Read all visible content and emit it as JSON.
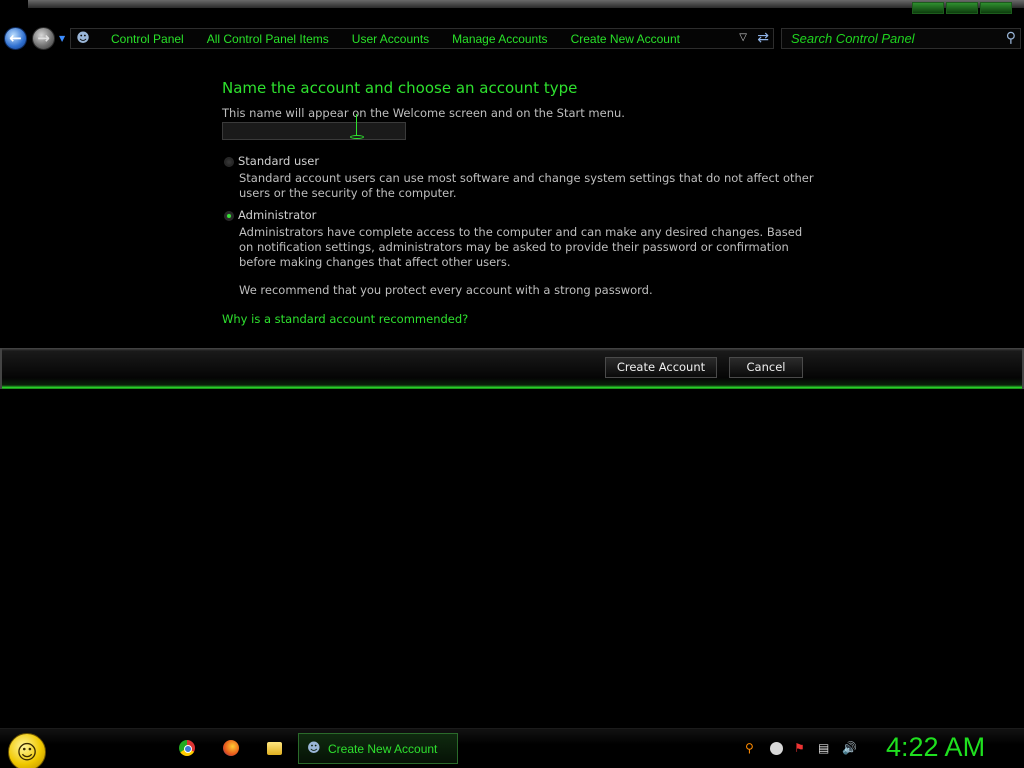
{
  "navigation": {
    "breadcrumbs": [
      "Control Panel",
      "All Control Panel Items",
      "User Accounts",
      "Manage Accounts",
      "Create New Account"
    ],
    "search_placeholder": "Search Control Panel"
  },
  "form": {
    "heading": "Name the account and choose an account type",
    "hint": "This name will appear on the Welcome screen and on the Start menu.",
    "name_value": "",
    "options": [
      {
        "label": "Standard user",
        "description": "Standard account users can use most software and change system settings that do not affect other users or the security of the computer.",
        "selected": false
      },
      {
        "label": "Administrator",
        "description": "Administrators have complete access to the computer and can make any desired changes. Based on notification settings, administrators may be asked to provide their password or confirmation before making changes that affect other users.",
        "selected": true
      }
    ],
    "recommendation": "We recommend that you protect every account with a strong password.",
    "help_link": "Why is a standard account recommended?"
  },
  "buttons": {
    "create": "Create Account",
    "cancel": "Cancel"
  },
  "taskbar": {
    "active_task": "Create New Account",
    "clock": "4:22 AM",
    "pinned_icons": [
      "chrome-icon",
      "firefox-icon",
      "folder-icon"
    ],
    "tray_icons": [
      "search-icon",
      "ball-icon",
      "flag-icon",
      "network-icon",
      "volume-icon"
    ]
  },
  "colors": {
    "accent": "#2ee02e",
    "background": "#000000"
  }
}
